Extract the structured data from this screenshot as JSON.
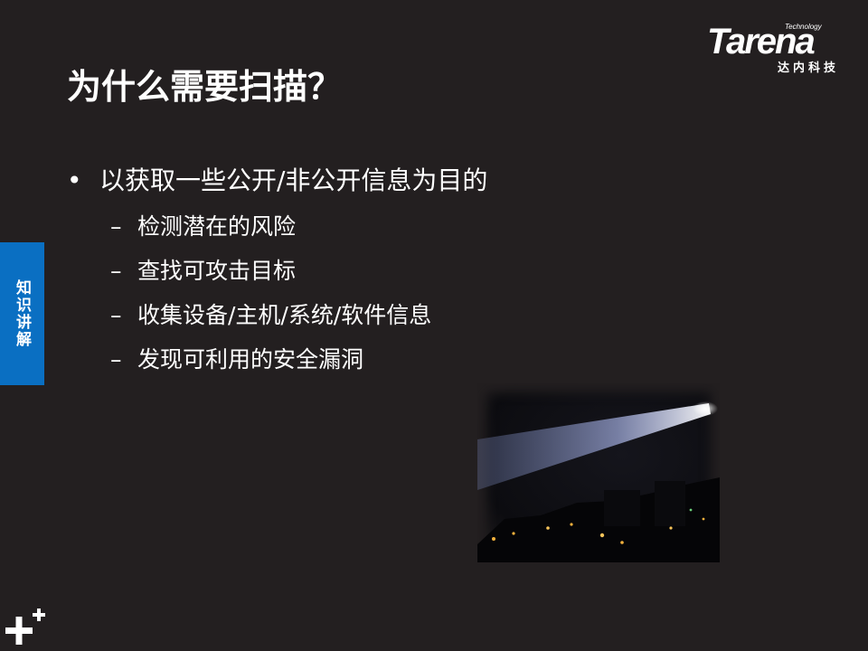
{
  "logo": {
    "small_text": "Technology",
    "main_text": "Tarena",
    "sub_text": "达内科技"
  },
  "title": "为什么需要扫描？",
  "side_tab": "知识讲解",
  "bullet": {
    "marker": "•",
    "text": "以获取一些公开/非公开信息为目的"
  },
  "sub_items": [
    {
      "marker": "–",
      "text": "检测潜在的风险"
    },
    {
      "marker": "–",
      "text": "查找可攻击目标"
    },
    {
      "marker": "–",
      "text": "收集设备/主机/系统/软件信息"
    },
    {
      "marker": "–",
      "text": "发现可利用的安全漏洞"
    }
  ],
  "photo": {
    "icon": "searchlight-night-photo"
  },
  "corner": {
    "icon": "plus-plus-icon"
  },
  "colors": {
    "background": "#231f20",
    "side_tab": "#0a6fc2",
    "text": "#ffffff"
  }
}
